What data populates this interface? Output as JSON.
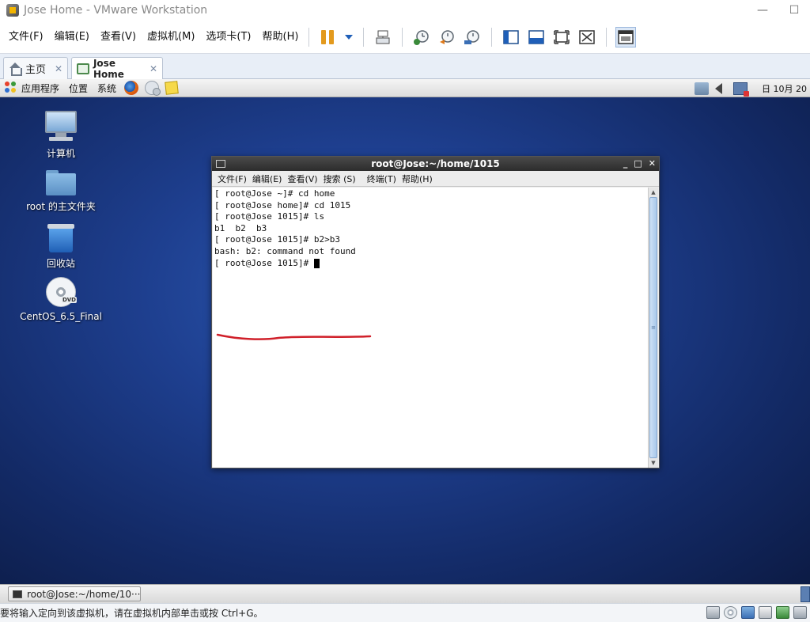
{
  "window": {
    "title": "Jose Home - VMware Workstation",
    "controls": {
      "minimize": "—",
      "maximize": "☐"
    }
  },
  "menubar": {
    "items": [
      "文件(F)",
      "编辑(E)",
      "查看(V)",
      "虚拟机(M)",
      "选项卡(T)",
      "帮助(H)"
    ],
    "toolbar_icons": [
      "pause-icon",
      "dropdown-arrow-icon",
      "send-ctrl-alt-del-icon",
      "snapshot-icon",
      "revert-snapshot-icon",
      "snapshot-manager-icon",
      "sidebar-toggle-icon",
      "console-view-icon",
      "fullscreen-icon",
      "unity-icon",
      "thumbnail-view-icon"
    ]
  },
  "tabs": [
    {
      "label": "主页",
      "icon": "home-icon",
      "close": "✕"
    },
    {
      "label": "Jose Home",
      "icon": "vm-icon",
      "close": "✕",
      "active": true
    }
  ],
  "guest": {
    "panel": {
      "applications": "应用程序",
      "places": "位置",
      "system": "系统",
      "clock": "日 10月 20"
    },
    "desktop_icons": [
      {
        "label": "计算机",
        "icon": "computer-icon"
      },
      {
        "label": "root 的主文件夹",
        "icon": "home-folder-icon"
      },
      {
        "label": "回收站",
        "icon": "trash-icon"
      },
      {
        "label": "CentOS_6.5_Final",
        "icon": "dvd-icon"
      }
    ],
    "terminal": {
      "title": "root@Jose:~/home/1015",
      "controls": {
        "minimize": "_",
        "maximize": "□",
        "close": "✕"
      },
      "menu": [
        "文件(F)",
        "编辑(E)",
        "查看(V)",
        "搜索 (S)",
        "终端(T)",
        "帮助(H)"
      ],
      "lines": [
        "[ root@Jose ~]# cd home",
        "[ root@Jose home]# cd 1015",
        "[ root@Jose 1015]# ls",
        "b1  b2  b3",
        "[ root@Jose 1015]# b2>b3",
        "bash: b2: command not found",
        "[ root@Jose 1015]# "
      ],
      "annotation_color": "#d0202a"
    },
    "taskbar": {
      "task_label": "root@Jose:~/home/10···"
    },
    "colors": {
      "desktop": "#1e3f8f",
      "accent": "#e39a1d"
    }
  },
  "statusbar": {
    "message": "要将输入定向到该虚拟机，请在虚拟机内部单击或按 Ctrl+G。",
    "icons": [
      "hard-disk-icon",
      "cd-icon",
      "network-icon",
      "printer-icon",
      "sound-icon",
      "usb-icon"
    ]
  }
}
